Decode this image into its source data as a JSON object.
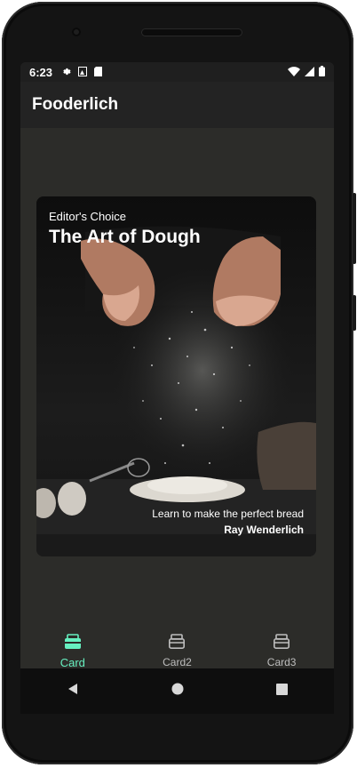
{
  "status_bar": {
    "time": "6:23"
  },
  "app_bar": {
    "title": "Fooderlich"
  },
  "card": {
    "eyebrow": "Editor's Choice",
    "title": "The Art of Dough",
    "description": "Learn to make the perfect bread",
    "author": "Ray Wenderlich"
  },
  "bottom_nav": {
    "items": [
      {
        "label": "Card",
        "active": true
      },
      {
        "label": "Card2",
        "active": false
      },
      {
        "label": "Card3",
        "active": false
      }
    ]
  },
  "colors": {
    "accent": "#66f0c0",
    "background": "#2c2c29",
    "app_bar": "#232323",
    "inactive": "#bdbdbd"
  }
}
